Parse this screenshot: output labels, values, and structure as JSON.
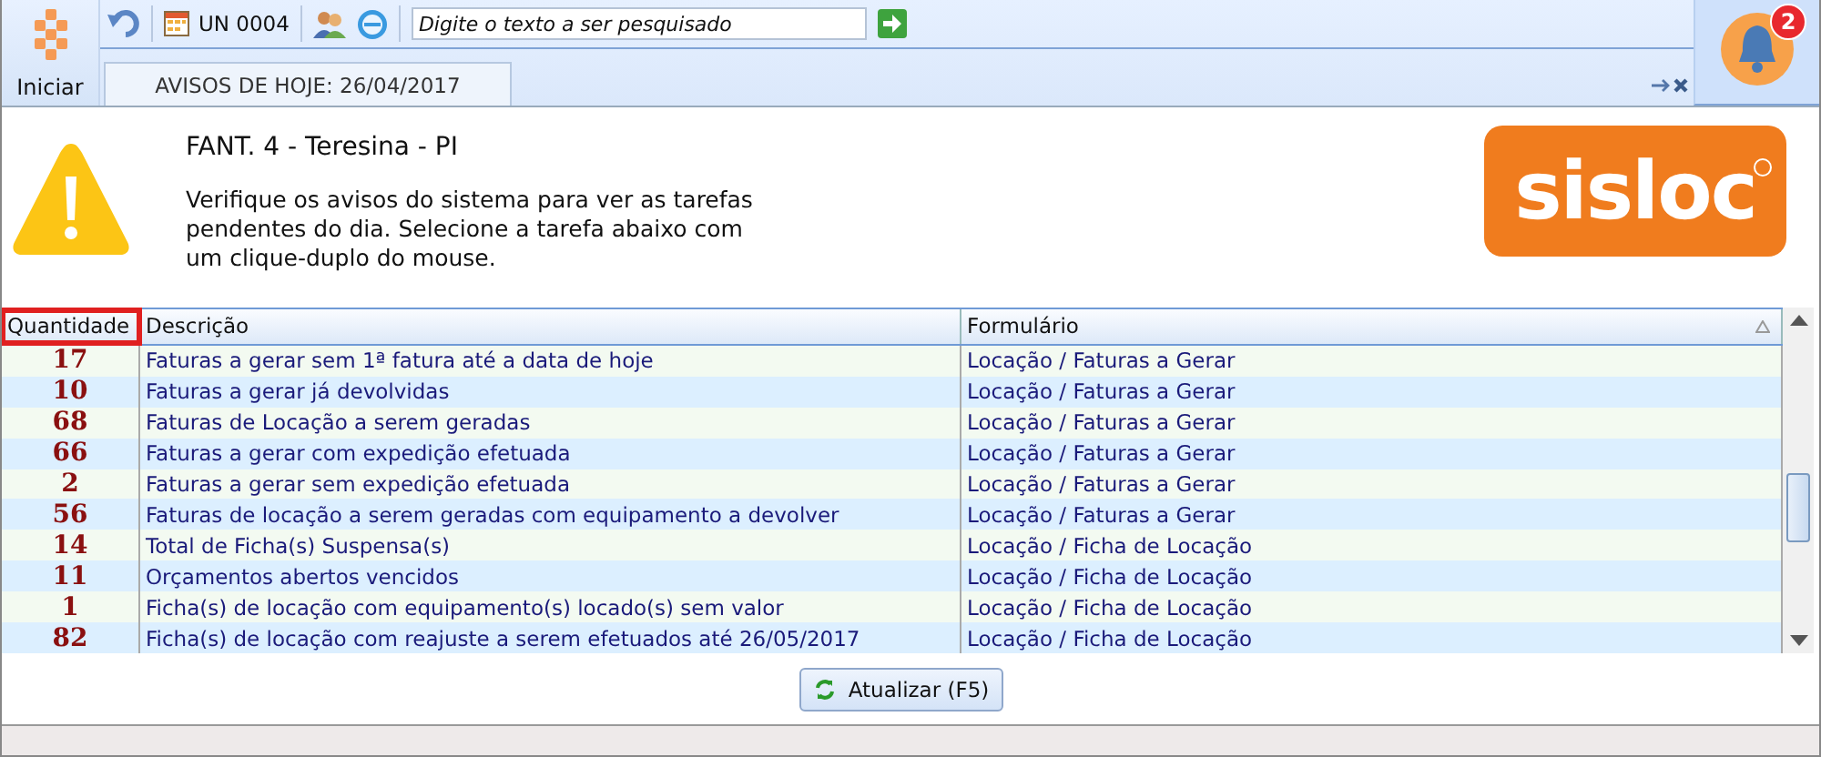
{
  "toolbar": {
    "start_label": "Iniciar",
    "unit": "UN 0004",
    "search": {
      "placeholder": "Digite o texto a ser pesquisado"
    },
    "notification_count": "2"
  },
  "tabs": [
    {
      "label": "AVISOS DE HOJE: 26/04/2017",
      "selected": true
    }
  ],
  "header": {
    "title": "FANT. 4 - Teresina - PI",
    "message": "Verifique os avisos do sistema para ver as tarefas pendentes do dia. Selecione a tarefa abaixo com um clique-duplo do mouse.",
    "logo": "sisloc"
  },
  "table": {
    "columns": [
      {
        "label": "Quantidade",
        "highlighted": true
      },
      {
        "label": "Descrição",
        "highlighted": false
      },
      {
        "label": "Formulário",
        "highlighted": false
      }
    ],
    "rows": [
      {
        "quantity": "17",
        "description": "Faturas a gerar sem 1ª fatura até a data de hoje",
        "form": "Locação / Faturas a Gerar"
      },
      {
        "quantity": "10",
        "description": "Faturas a gerar já devolvidas",
        "form": "Locação / Faturas a Gerar"
      },
      {
        "quantity": "68",
        "description": "Faturas de Locação a serem geradas",
        "form": "Locação / Faturas a Gerar"
      },
      {
        "quantity": "66",
        "description": "Faturas a gerar com expedição efetuada",
        "form": "Locação / Faturas a Gerar"
      },
      {
        "quantity": "2",
        "description": "Faturas a gerar sem expedição efetuada",
        "form": "Locação / Faturas a Gerar"
      },
      {
        "quantity": "56",
        "description": "Faturas de locação a serem geradas com equipamento a devolver",
        "form": "Locação / Faturas a Gerar"
      },
      {
        "quantity": "14",
        "description": "Total de Ficha(s) Suspensa(s)",
        "form": "Locação / Ficha de Locação"
      },
      {
        "quantity": "11",
        "description": "Orçamentos abertos vencidos",
        "form": "Locação / Ficha de Locação"
      },
      {
        "quantity": "1",
        "description": "Ficha(s) de locação com equipamento(s) locado(s) sem valor",
        "form": "Locação / Ficha de Locação"
      },
      {
        "quantity": "82",
        "description": "Ficha(s) de locação com reajuste a serem efetuados até 26/05/2017",
        "form": "Locação / Ficha de Locação"
      }
    ]
  },
  "refresh_button": "Atualizar (F5)"
}
